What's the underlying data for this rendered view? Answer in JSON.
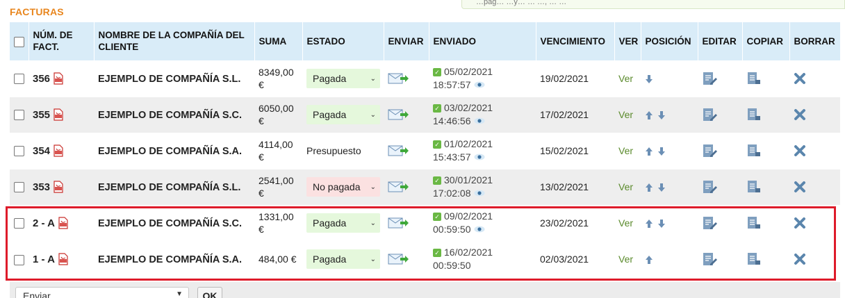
{
  "notice": {
    "text": "…pag… …y… … …, … …"
  },
  "section": {
    "title": "FACTURAS"
  },
  "table": {
    "headers": {
      "num": "NÚM. DE FACT.",
      "client": "NOMBRE DE LA COMPAÑÍA DEL CLIENTE",
      "suma": "SUMA",
      "estado": "ESTADO",
      "enviar": "ENVIAR",
      "enviado": "ENVIADO",
      "vencimiento": "VENCIMIENTO",
      "ver": "VER",
      "posicion": "POSICIÓN",
      "editar": "EDITAR",
      "copiar": "COPIAR",
      "borrar": "BORRAR"
    },
    "rows": [
      {
        "num": "356",
        "client": "EJEMPLO DE COMPAÑÍA S.L.",
        "suma": "8349,00 €",
        "estado": "Pagada",
        "estado_type": "select-paid",
        "sent_date": "05/02/2021",
        "sent_time": "18:57:57",
        "viewed": true,
        "due": "19/02/2021",
        "ver": "Ver",
        "pos_up": false,
        "pos_down": true
      },
      {
        "num": "355",
        "client": "EJEMPLO DE COMPAÑÍA S.C.",
        "suma": "6050,00 €",
        "estado": "Pagada",
        "estado_type": "select-paid",
        "sent_date": "03/02/2021",
        "sent_time": "14:46:56",
        "viewed": true,
        "due": "17/02/2021",
        "ver": "Ver",
        "pos_up": true,
        "pos_down": true
      },
      {
        "num": "354",
        "client": "EJEMPLO DE COMPAÑÍA S.A.",
        "suma": "4114,00 €",
        "estado": "Presupuesto",
        "estado_type": "text",
        "sent_date": "01/02/2021",
        "sent_time": "15:43:57",
        "viewed": true,
        "due": "15/02/2021",
        "ver": "Ver",
        "pos_up": true,
        "pos_down": true
      },
      {
        "num": "353",
        "client": "EJEMPLO DE COMPAÑÍA S.L.",
        "suma": "2541,00 €",
        "estado": "No pagada",
        "estado_type": "select-unpaid",
        "sent_date": "30/01/2021",
        "sent_time": "17:02:08",
        "viewed": true,
        "due": "13/02/2021",
        "ver": "Ver",
        "pos_up": true,
        "pos_down": true
      },
      {
        "num": "2 - A",
        "client": "EJEMPLO DE COMPAÑÍA S.C.",
        "suma": "1331,00 €",
        "estado": "Pagada",
        "estado_type": "select-paid",
        "sent_date": "09/02/2021",
        "sent_time": "00:59:50",
        "viewed": true,
        "due": "23/02/2021",
        "ver": "Ver",
        "pos_up": true,
        "pos_down": true
      },
      {
        "num": "1 - A",
        "client": "EJEMPLO DE COMPAÑÍA S.A.",
        "suma": "484,00 €",
        "estado": "Pagada",
        "estado_type": "select-paid",
        "sent_date": "16/02/2021",
        "sent_time": "00:59:50",
        "viewed": false,
        "due": "02/03/2021",
        "ver": "Ver",
        "pos_up": true,
        "pos_down": false
      }
    ]
  },
  "footer": {
    "bulk_select": "Enviar…",
    "ok_label": "OK"
  },
  "colors": {
    "accent": "#e8861e",
    "header_bg": "#d9ecf8",
    "paid_bg": "#e5f8dc",
    "unpaid_bg": "#fbe1e1",
    "highlight": "#de1b2a",
    "link": "#5a8a2b",
    "icon": "#6b8fb5"
  }
}
